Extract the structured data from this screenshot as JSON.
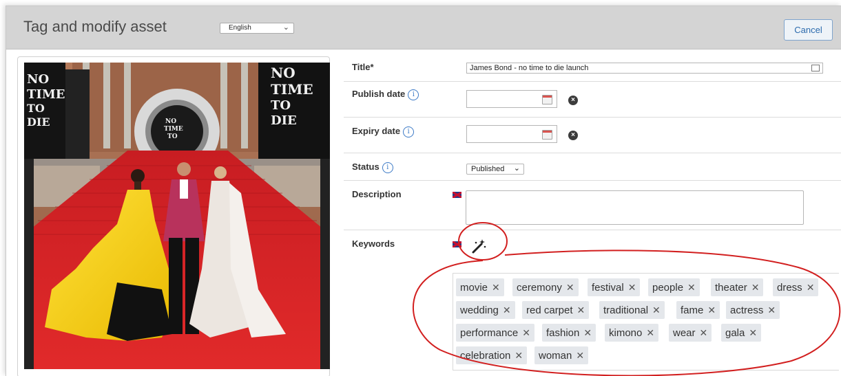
{
  "header": {
    "title": "Tag and modify asset",
    "language": "English",
    "cancel_label": "Cancel"
  },
  "form": {
    "title_label": "Title*",
    "title_value": "James Bond - no time to die launch",
    "publish_label": "Publish date",
    "expiry_label": "Expiry date",
    "status_label": "Status",
    "status_value": "Published",
    "description_label": "Description",
    "keywords_label": "Keywords"
  },
  "photo": {
    "screen_text": [
      "NO",
      "TIME",
      "TO",
      "DIE"
    ]
  },
  "keywords": [
    "movie",
    "ceremony",
    "festival",
    "people",
    "theater",
    "dress",
    "wedding",
    "red carpet",
    "traditional",
    "fame",
    "actress",
    "performance",
    "fashion",
    "kimono",
    "wear",
    "gala",
    "celebration",
    "woman"
  ],
  "colors": {
    "header_bg": "#d4d4d4",
    "link_blue": "#2c6bad",
    "red_carpet": "#d8232a",
    "annotation_red": "#d21f1f",
    "tag_bg": "#e4e7eb"
  },
  "icons": {
    "info": "info-circle-icon",
    "calendar": "calendar-icon",
    "clear": "clear-x-icon",
    "flag": "uk-flag-icon",
    "magic": "magic-wand-icon"
  }
}
